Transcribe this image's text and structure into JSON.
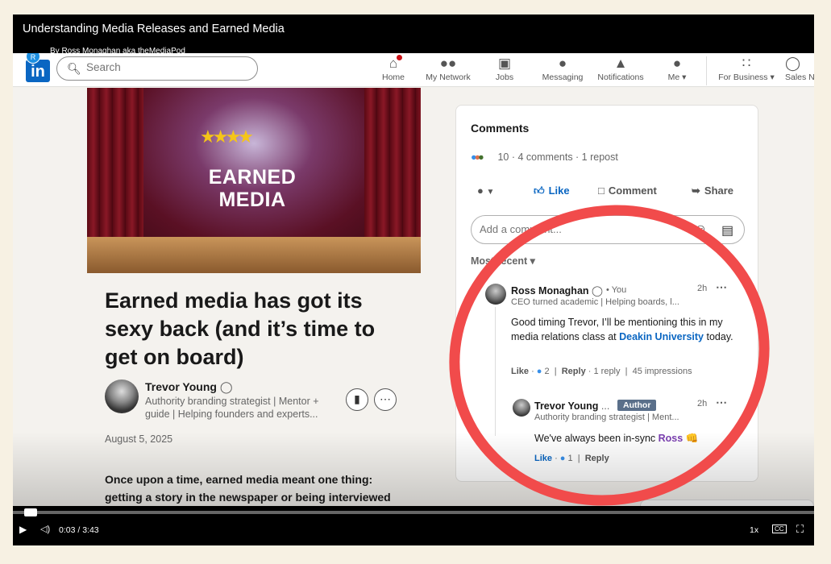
{
  "video": {
    "title": "Understanding Media Releases and Earned Media",
    "subtitle": "By Ross Monaghan aka theMediaPod",
    "time_display": "0:03 / 3:43",
    "progress_fraction": 0.014,
    "speed": "1x",
    "cc_label": "CC"
  },
  "linkedin": {
    "logo": "in",
    "profile_initial": "R",
    "search_placeholder": "Search",
    "nav": [
      {
        "label": "Home",
        "icon": "home-icon"
      },
      {
        "label": "My Network",
        "icon": "network-icon"
      },
      {
        "label": "Jobs",
        "icon": "briefcase-icon"
      },
      {
        "label": "Messaging",
        "icon": "chat-icon"
      },
      {
        "label": "Notifications",
        "icon": "bell-icon"
      },
      {
        "label": "Me ▾",
        "icon": "avatar"
      },
      {
        "label": "For Business ▾",
        "icon": "grid-icon"
      },
      {
        "label": "Sales N",
        "icon": "compass-icon"
      }
    ]
  },
  "article": {
    "hero_text": "EARNED MEDIA",
    "headline": "Earned media has got its sexy back (and it’s time to get on board)",
    "author_name": "Trevor Young",
    "author_desc": "Authority branding strategist | Mentor + guide | Helping founders and experts...",
    "date": "August 5, 2025",
    "lead": "Once upon a time, earned media meant one thing: getting a story in the newspaper or being interviewed"
  },
  "comments": {
    "title": "Comments",
    "stats": "10 · 4 comments · 1 repost",
    "actions": {
      "like": "Like",
      "comment": "Comment",
      "share": "Share"
    },
    "input_placeholder": "Add a comment...",
    "sort_label": "Most recent ▾",
    "items": [
      {
        "name": "Ross Monaghan",
        "you": "• You",
        "desc": "CEO turned academic | Helping boards, l...",
        "time": "2h",
        "body_pre": "Good timing Trevor, I’ll be mentioning this in my media relations class at ",
        "body_link": "Deakin University",
        "body_post": " today.",
        "like": "Like",
        "like_count": "2",
        "reply": "Reply",
        "reply_count": "· 1 reply",
        "impressions": "45 impressions"
      },
      {
        "name": "Trevor Young",
        "tag": "Author",
        "desc": "Authority branding strategist | Ment...",
        "time": "2h",
        "body_pre": "We've always been in-sync ",
        "body_mention": "Ross",
        "body_post": " 👊",
        "like": "Like",
        "like_count": "1",
        "reply": "Reply"
      }
    ]
  },
  "colors": {
    "linkedin_blue": "#0a66c2",
    "annotation_red": "#f14b4b",
    "author_tag": "#5a6f8a",
    "page_bg": "#f7f1e3"
  }
}
